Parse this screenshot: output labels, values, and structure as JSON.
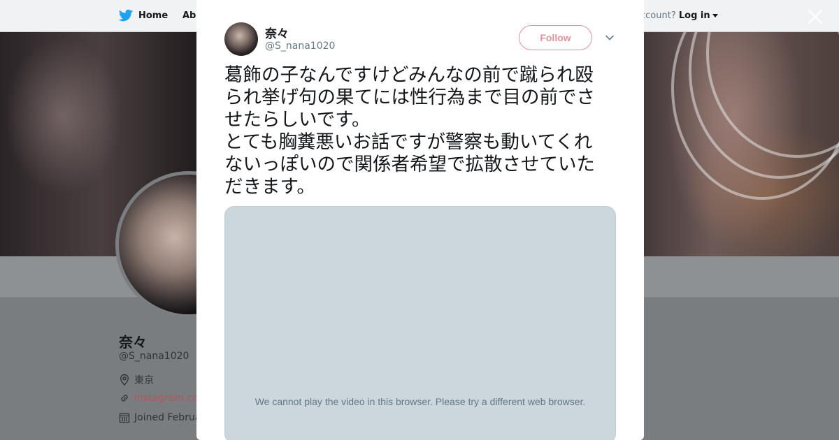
{
  "nav": {
    "home_label": "Home",
    "about_label": "Abo",
    "account_prompt": "ccount?",
    "login_label": "Log in"
  },
  "profile": {
    "name": "奈々",
    "handle": "@S_nana1020",
    "location": "東京",
    "website": "Instagram.con",
    "joined": "Joined Februa"
  },
  "tweet": {
    "author_name": "奈々",
    "author_handle": "@S_nana1020",
    "follow_label": "Follow",
    "text": "葛飾の子なんですけどみんなの前で蹴られ殴\nられ挙げ句の果てには性行為まで目の前でさ\nせたらしいです。\nとても胸糞悪いお話ですが警察も動いてくれ\nないっぽいので関係者希望で拡散させていた\nだきます。",
    "video_message": "We cannot play the video in this browser. Please try a different web browser."
  },
  "colors": {
    "follow_accent": "#e3909a",
    "twitter_blue": "#1da1f2",
    "link_color": "#b0555e"
  },
  "icons": [
    "twitter-bird-icon",
    "close-icon",
    "chevron-down-icon",
    "location-pin-icon",
    "link-icon",
    "calendar-icon"
  ]
}
